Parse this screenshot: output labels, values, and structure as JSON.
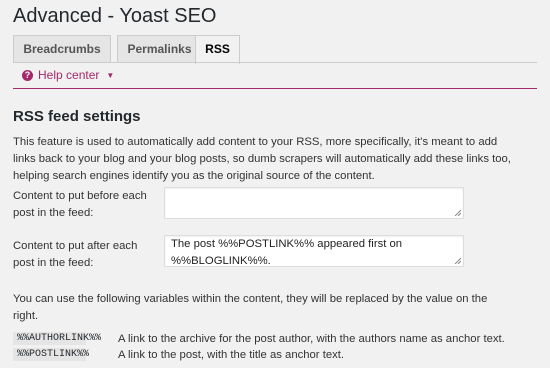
{
  "page": {
    "title": "Advanced - Yoast SEO"
  },
  "tabs": [
    {
      "label": "Breadcrumbs",
      "active": false
    },
    {
      "label": "Permalinks",
      "active": false
    },
    {
      "label": "RSS",
      "active": true
    }
  ],
  "help": {
    "label": "Help center",
    "icon": "question-circle-icon",
    "accent": "#a4286a"
  },
  "section": {
    "title": "RSS feed settings",
    "description": "This feature is used to automatically add content to your RSS, more specifically, it's meant to add links back to your blog and your blog posts, so dumb scrapers will automatically add these links too, helping search engines identify you as the original source of the content."
  },
  "fields": {
    "before": {
      "label": "Content to put before each post in the feed:",
      "value": ""
    },
    "after": {
      "label": "Content to put after each post in the feed:",
      "value": "The post %%POSTLINK%% appeared first on %%BLOGLINK%%."
    }
  },
  "variables": {
    "intro": "You can use the following variables within the content, they will be replaced by the value on the right.",
    "rows": [
      {
        "code": "%%AUTHORLINK%%",
        "desc": "A link to the archive for the post author, with the authors name as anchor text."
      },
      {
        "code": "%%POSTLINK%%",
        "desc": "A link to the post, with the title as anchor text."
      }
    ]
  }
}
